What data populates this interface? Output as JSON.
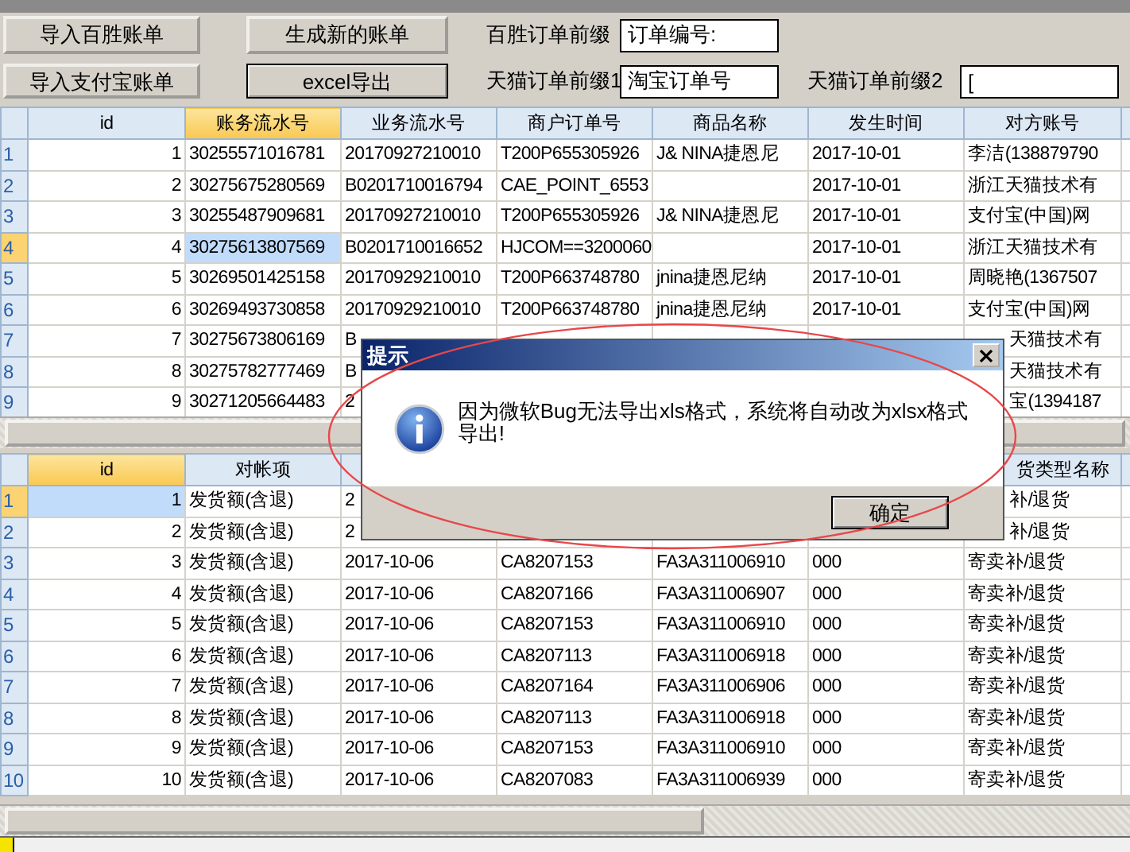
{
  "toolbar": {
    "buttons": [
      {
        "label": "导入百胜账单",
        "default": false
      },
      {
        "label": "生成新的账单",
        "default": false
      },
      {
        "label": "导入支付宝账单",
        "default": false
      },
      {
        "label": "excel导出",
        "default": true
      }
    ],
    "fields": [
      {
        "label": "百胜订单前缀",
        "value": "订单编号:"
      },
      {
        "label": "天猫订单前缀1",
        "value": "淘宝订单号"
      },
      {
        "label": "天猫订单前缀2",
        "value": "["
      }
    ]
  },
  "grid_top": {
    "columns": [
      {
        "label": "id",
        "selected": false
      },
      {
        "label": "账务流水号",
        "selected": true
      },
      {
        "label": "业务流水号",
        "selected": false
      },
      {
        "label": "商户订单号",
        "selected": false
      },
      {
        "label": "商品名称",
        "selected": false
      },
      {
        "label": "发生时间",
        "selected": false
      },
      {
        "label": "对方账号",
        "selected": false
      }
    ],
    "rows": [
      {
        "row_number": "1",
        "selected": false,
        "cells": [
          "1",
          "30255571016781",
          "20170927210010",
          "T200P655305926",
          "J& NINA捷恩尼",
          "2017-10-01",
          "李洁(138879790"
        ]
      },
      {
        "row_number": "2",
        "selected": false,
        "cells": [
          "2",
          "30275675280569",
          "B0201710016794",
          "CAE_POINT_6553",
          null,
          "2017-10-01",
          "浙江天猫技术有"
        ]
      },
      {
        "row_number": "3",
        "selected": false,
        "cells": [
          "3",
          "30255487909681",
          "20170927210010",
          "T200P655305926",
          "J& NINA捷恩尼",
          "2017-10-01",
          "支付宝(中国)网"
        ]
      },
      {
        "row_number": "4",
        "selected": true,
        "cells": [
          "4",
          "30275613807569",
          "B0201710016652",
          "HJCOM==3200060",
          null,
          "2017-10-01",
          "浙江天猫技术有"
        ]
      },
      {
        "row_number": "5",
        "selected": false,
        "cells": [
          "5",
          "30269501425158",
          "20170929210010",
          "T200P663748780",
          "jnina捷恩尼纳",
          "2017-10-01",
          "周晓艳(1367507"
        ]
      },
      {
        "row_number": "6",
        "selected": false,
        "cells": [
          "6",
          "30269493730858",
          "20170929210010",
          "T200P663748780",
          "jnina捷恩尼纳",
          "2017-10-01",
          "支付宝(中国)网"
        ]
      },
      {
        "row_number": "7",
        "selected": false,
        "cells": [
          "7",
          "30275673806169",
          "B",
          null,
          null,
          null,
          "天猫技术有"
        ]
      },
      {
        "row_number": "8",
        "selected": false,
        "cells": [
          "8",
          "30275782777469",
          "B",
          null,
          null,
          null,
          "天猫技术有"
        ]
      },
      {
        "row_number": "9",
        "selected": false,
        "cells": [
          "9",
          "30271205664483",
          "2",
          null,
          null,
          null,
          "宝(1394187"
        ]
      }
    ]
  },
  "grid_bottom": {
    "columns": [
      {
        "label": "id",
        "selected": true
      },
      {
        "label": "对帐项",
        "selected": false
      },
      {},
      {},
      {},
      {},
      {
        "label": "货类型名称",
        "selected": false
      }
    ],
    "rows": [
      {
        "row_number": "1",
        "selected": true,
        "cells": [
          "1",
          "发货额(含退)",
          "2",
          null,
          null,
          null,
          "补/退货"
        ]
      },
      {
        "row_number": "2",
        "selected": false,
        "cells": [
          "2",
          "发货额(含退)",
          "2",
          null,
          null,
          null,
          "补/退货"
        ]
      },
      {
        "row_number": "3",
        "selected": false,
        "cells": [
          "3",
          "发货额(含退)",
          "2017-10-06",
          "CA8207153",
          "FA3A311006910",
          "000",
          "寄卖补/退货"
        ]
      },
      {
        "row_number": "4",
        "selected": false,
        "cells": [
          "4",
          "发货额(含退)",
          "2017-10-06",
          "CA8207166",
          "FA3A311006907",
          "000",
          "寄卖补/退货"
        ]
      },
      {
        "row_number": "5",
        "selected": false,
        "cells": [
          "5",
          "发货额(含退)",
          "2017-10-06",
          "CA8207153",
          "FA3A311006910",
          "000",
          "寄卖补/退货"
        ]
      },
      {
        "row_number": "6",
        "selected": false,
        "cells": [
          "6",
          "发货额(含退)",
          "2017-10-06",
          "CA8207113",
          "FA3A311006918",
          "000",
          "寄卖补/退货"
        ]
      },
      {
        "row_number": "7",
        "selected": false,
        "cells": [
          "7",
          "发货额(含退)",
          "2017-10-06",
          "CA8207164",
          "FA3A311006906",
          "000",
          "寄卖补/退货"
        ]
      },
      {
        "row_number": "8",
        "selected": false,
        "cells": [
          "8",
          "发货额(含退)",
          "2017-10-06",
          "CA8207113",
          "FA3A311006918",
          "000",
          "寄卖补/退货"
        ]
      },
      {
        "row_number": "9",
        "selected": false,
        "cells": [
          "9",
          "发货额(含退)",
          "2017-10-06",
          "CA8207153",
          "FA3A311006910",
          "000",
          "寄卖补/退货"
        ]
      },
      {
        "row_number": "10",
        "selected": false,
        "cells": [
          "10",
          "发货额(含退)",
          "2017-10-06",
          "CA8207083",
          "FA3A311006939",
          "000",
          "寄卖补/退货"
        ]
      }
    ]
  },
  "dialog": {
    "title": "提示",
    "message": "因为微软Bug无法导出xls格式，系统将自动改为xlsx格式导出!",
    "button": "确定"
  }
}
